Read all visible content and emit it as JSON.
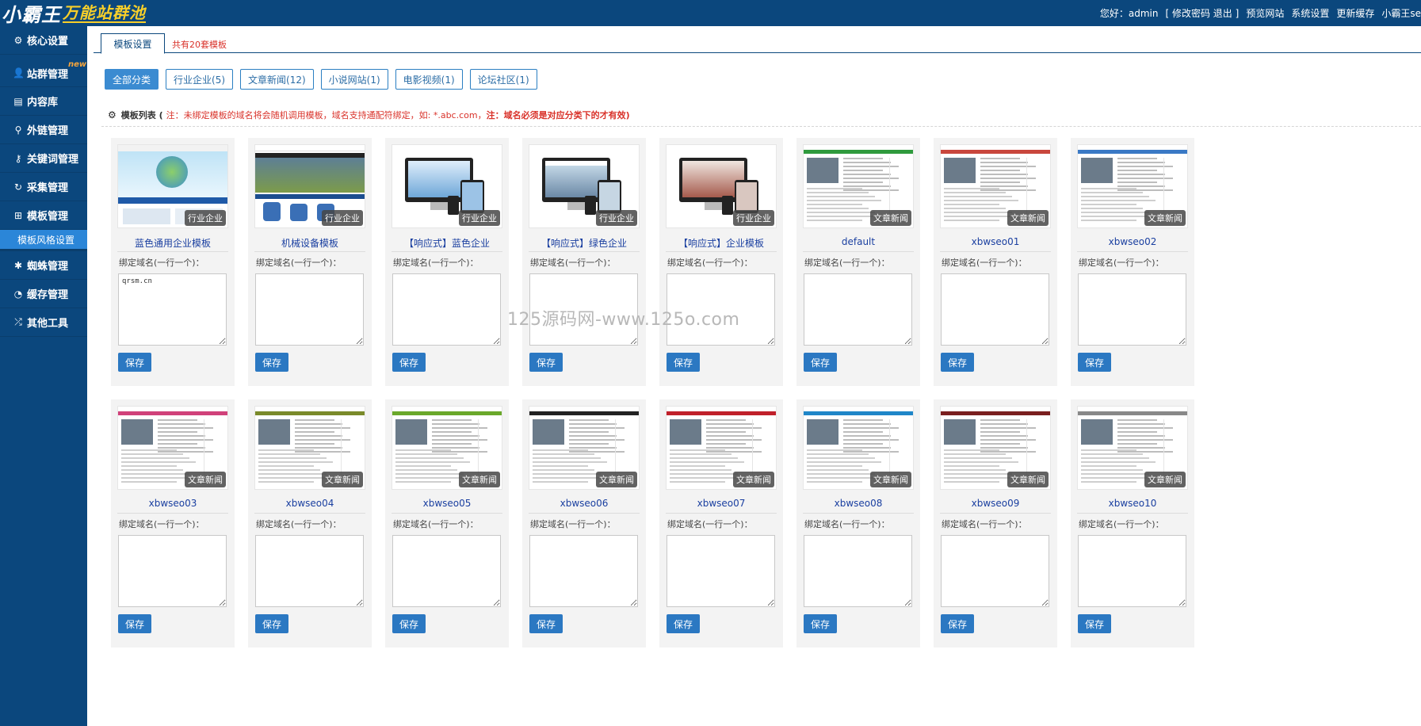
{
  "header": {
    "logo_main": "小霸王",
    "logo_sub": "万能站群池",
    "greeting": "您好：admin",
    "links": [
      "[ 修改密码 退出 ]",
      "预览网站",
      "系统设置",
      "更新缓存",
      "小霸王se"
    ]
  },
  "sidebar": {
    "items": [
      {
        "label": "核心设置",
        "icon": "gear-icon"
      },
      {
        "label": "站群管理",
        "icon": "user-icon",
        "badge": "new"
      },
      {
        "label": "内容库",
        "icon": "document-icon"
      },
      {
        "label": "外链管理",
        "icon": "link-icon"
      },
      {
        "label": "关键词管理",
        "icon": "key-icon"
      },
      {
        "label": "采集管理",
        "icon": "refresh-icon"
      },
      {
        "label": "模板管理",
        "icon": "windows-icon"
      },
      {
        "label": "蜘蛛管理",
        "icon": "spider-icon"
      },
      {
        "label": "缓存管理",
        "icon": "dashboard-icon"
      },
      {
        "label": "其他工具",
        "icon": "shuffle-icon"
      }
    ],
    "subitem": "模板风格设置"
  },
  "tabs": {
    "active": "模板设置",
    "count": "共有20套模板"
  },
  "filters": [
    "全部分类",
    "行业企业(5)",
    "文章新闻(12)",
    "小说网站(1)",
    "电影视频(1)",
    "论坛社区(1)"
  ],
  "list_header": {
    "title": "模板列表 (",
    "note_normal": "注：未绑定模板的域名将会随机调用模板，域名支持通配符绑定，如: *.abc.com，",
    "note_bold": "注：域名必须是对应分类下的才有效)"
  },
  "card_common": {
    "bind_label": "绑定域名(一行一个)：",
    "save_label": "保存"
  },
  "templates": [
    {
      "name": "蓝色通用企业模板",
      "tag": "行业企业",
      "domains": "qrsm.cn",
      "style": "blue"
    },
    {
      "name": "机械设备模板",
      "tag": "行业企业",
      "domains": "",
      "style": "machine"
    },
    {
      "name": "【响应式】蓝色企业",
      "tag": "行业企业",
      "domains": "",
      "style": "device"
    },
    {
      "name": "【响应式】绿色企业",
      "tag": "行业企业",
      "domains": "",
      "style": "device2"
    },
    {
      "name": "【响应式】企业模板",
      "tag": "行业企业",
      "domains": "",
      "style": "device3"
    },
    {
      "name": "default",
      "tag": "文章新闻",
      "domains": "",
      "style": "news-green"
    },
    {
      "name": "xbwseo01",
      "tag": "文章新闻",
      "domains": "",
      "style": "news-red"
    },
    {
      "name": "xbwseo02",
      "tag": "文章新闻",
      "domains": "",
      "style": "news-blue"
    },
    {
      "name": "xbwseo03",
      "tag": "文章新闻",
      "domains": "",
      "style": "news-pink"
    },
    {
      "name": "xbwseo04",
      "tag": "文章新闻",
      "domains": "",
      "style": "news-olive"
    },
    {
      "name": "xbwseo05",
      "tag": "文章新闻",
      "domains": "",
      "style": "news-lime"
    },
    {
      "name": "xbwseo06",
      "tag": "文章新闻",
      "domains": "",
      "style": "news-dark"
    },
    {
      "name": "xbwseo07",
      "tag": "文章新闻",
      "domains": "",
      "style": "news-crimson"
    },
    {
      "name": "xbwseo08",
      "tag": "文章新闻",
      "domains": "",
      "style": "news-cyan"
    },
    {
      "name": "xbwseo09",
      "tag": "文章新闻",
      "domains": "",
      "style": "news-maroon"
    },
    {
      "name": "xbwseo10",
      "tag": "文章新闻",
      "domains": "",
      "style": "news-gray"
    }
  ],
  "watermark": "125源码网-www.125o.com"
}
